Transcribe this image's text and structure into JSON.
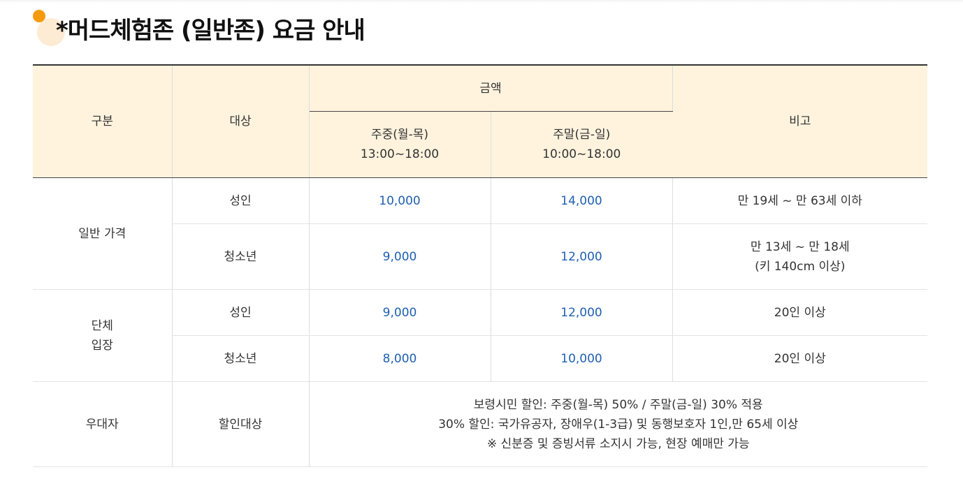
{
  "title": "*머드체험존 (일반존) 요금 안내",
  "headers": {
    "category": "구분",
    "target": "대상",
    "amount": "금액",
    "weekday_line1": "주중(월-목)",
    "weekday_line2": "13:00~18:00",
    "weekend_line1": "주말(금-일)",
    "weekend_line2": "10:00~18:00",
    "note": "비고"
  },
  "rows": {
    "general": {
      "category": "일반 가격",
      "adult": {
        "target": "성인",
        "weekday": "10,000",
        "weekend": "14,000",
        "note": "만 19세 ~ 만 63세 이하"
      },
      "youth": {
        "target": "청소년",
        "weekday": "9,000",
        "weekend": "12,000",
        "note_line1": "만 13세 ~ 만 18세",
        "note_line2": "(키 140cm 이상)"
      }
    },
    "group": {
      "category_line1": "단체",
      "category_line2": "입장",
      "adult": {
        "target": "성인",
        "weekday": "9,000",
        "weekend": "12,000",
        "note": "20인 이상"
      },
      "youth": {
        "target": "청소년",
        "weekday": "8,000",
        "weekend": "10,000",
        "note": "20인 이상"
      }
    },
    "discount": {
      "category": "우대자",
      "target": "할인대상",
      "lines": [
        "보령시민 할인: 주중(월-목) 50% / 주말(금-일) 30% 적용",
        "30% 할인: 국가유공자, 장애우(1-3급) 및 동행보호자 1인,만 65세 이상",
        "※ 신분증 및 증빙서류 소지시 가능, 현장 예매만 가능"
      ]
    }
  },
  "colors": {
    "header_bg": "#fff3de",
    "price_text": "#1f5fb0",
    "accent_orange": "#f59a0c",
    "accent_light": "#fdebd3"
  }
}
